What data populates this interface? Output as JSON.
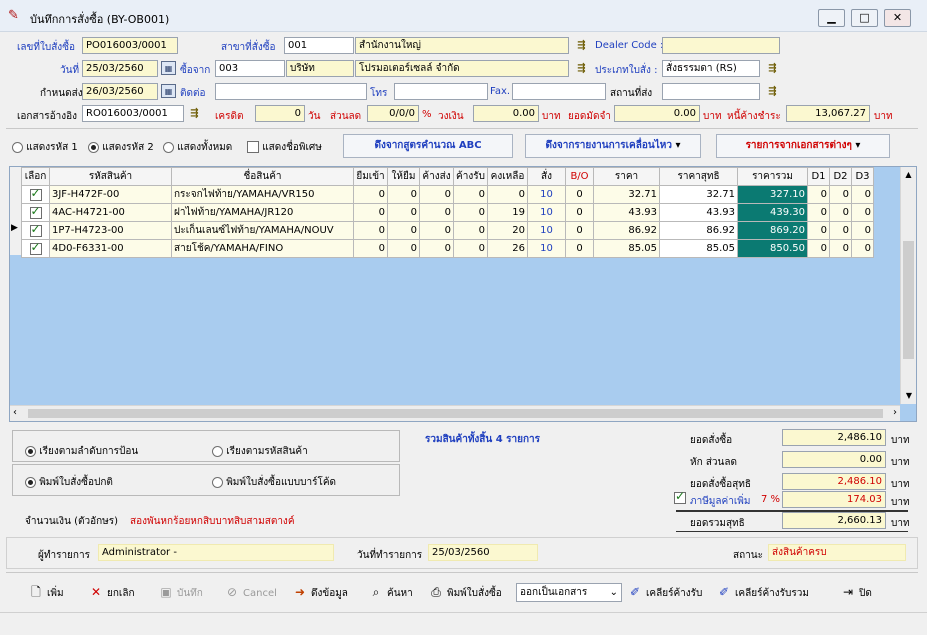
{
  "window": {
    "title": "บันทึกการสั่งซื้อ (BY-OB001)",
    "min": "▁",
    "max": "□",
    "close": "✕"
  },
  "header": {
    "doc_no_label": "เลขที่ใบสั่งซื้อ",
    "doc_no": "PO016003/0001",
    "branch_label": "สาขาที่สั่งซื้อ",
    "branch_code": "001",
    "branch_name": "สำนักงานใหญ่",
    "dealer_label": "Dealer Code :",
    "dealer_value": "",
    "date_label": "วันที่",
    "date": "25/03/2560",
    "buy_from_label": "ซื้อจาก",
    "vendor_code": "003",
    "vendor_type": "บริษัท",
    "vendor_name": "โปรมอเตอร์เซลล์ จำกัด",
    "order_type_label": "ประเภทใบสั่ง :",
    "order_type": "สั่งธรรมดา (RS)",
    "due_label": "กำหนดส่ง",
    "due_date": "26/03/2560",
    "contact_label": "ติดต่อ",
    "contact": "",
    "tel_label": "โทร",
    "tel": "",
    "fax_label": "Fax.",
    "fax": "",
    "ship_label": "สถานที่ส่ง",
    "ship": "",
    "ref_label": "เอกสารอ้างอิง",
    "ref_no": "RO016003/0001",
    "credit_label": "เครดิต",
    "credit": "0",
    "days_label": "วัน",
    "discount_label": "ส่วนลด",
    "discount": "0/0/0",
    "pct": "%",
    "limit_label": "วงเงิน",
    "limit": "0.00",
    "baht1": "บาท",
    "deposit_label": "ยอดมัดจำ",
    "deposit": "0.00",
    "baht2": "บาท",
    "debt_label": "หนี้ค้างชำระ",
    "debt": "13,067.27",
    "baht3": "บาท"
  },
  "options": {
    "show_code1": "แสดงรหัส 1",
    "show_code2": "แสดงรหัส 2",
    "show_all": "แสดงทั้งหมด",
    "show_special": "แสดงชื่อพิเศษ",
    "btn_abc": "ดึงจากสูตรคำนวณ ABC",
    "btn_movement": "ดึงจากรายงานการเคลื่อนไหว",
    "btn_docs": "รายการจากเอกสารต่างๆ"
  },
  "grid": {
    "columns": [
      "เลือก",
      "รหัสสินค้า",
      "ชื่อสินค้า",
      "ยืมเข้า",
      "ให้ยืม",
      "ค้างส่ง",
      "ค้างรับ",
      "คงเหลือ",
      "สั่ง",
      "B/O",
      "ราคา",
      "ราคาสุทธิ",
      "ราคารวม",
      "D1",
      "D2",
      "D3"
    ],
    "rows": [
      {
        "code": "3JF-H472F-00",
        "name": "กระจกไฟท้าย/YAMAHA/VR150",
        "borrow_in": "0",
        "lend": "0",
        "pend_send": "0",
        "pend_recv": "0",
        "stock": "0",
        "qty": "10",
        "bo": "0",
        "price": "32.71",
        "net": "32.71",
        "total": "327.10",
        "d1": "0",
        "d2": "0",
        "d3": "0"
      },
      {
        "code": "4AC-H4721-00",
        "name": "ฝาไฟท้าย/YAMAHA/JR120",
        "borrow_in": "0",
        "lend": "0",
        "pend_send": "0",
        "pend_recv": "0",
        "stock": "19",
        "qty": "10",
        "bo": "0",
        "price": "43.93",
        "net": "43.93",
        "total": "439.30",
        "d1": "0",
        "d2": "0",
        "d3": "0"
      },
      {
        "code": "1P7-H4723-00",
        "name": "ปะเก็นเลนซ์ไฟท้าย/YAMAHA/NOUV",
        "borrow_in": "0",
        "lend": "0",
        "pend_send": "0",
        "pend_recv": "0",
        "stock": "20",
        "qty": "10",
        "bo": "0",
        "price": "86.92",
        "net": "86.92",
        "total": "869.20",
        "d1": "0",
        "d2": "0",
        "d3": "0"
      },
      {
        "code": "4D0-F6331-00",
        "name": "สายโช้ค/YAMAHA/FINO",
        "borrow_in": "0",
        "lend": "0",
        "pend_send": "0",
        "pend_recv": "0",
        "stock": "26",
        "qty": "10",
        "bo": "0",
        "price": "85.05",
        "net": "85.05",
        "total": "850.50",
        "d1": "0",
        "d2": "0",
        "d3": "0"
      }
    ]
  },
  "sort": {
    "by_entry": "เรียงตามลำดับการป้อน",
    "by_code": "เรียงตามรหัสสินค้า",
    "print_normal": "พิมพ์ใบสั่งซื้อปกติ",
    "print_barcode": "พิมพ์ใบสั่งซื้อแบบบาร์โค้ด"
  },
  "summary": {
    "items_text": "รวมสินค้าทั้งสิ้น 4 รายการ",
    "total_label": "ยอดสั่งซื้อ",
    "total": "2,486.10",
    "disc_label": "หัก ส่วนลด",
    "disc": "0.00",
    "net_label": "ยอดสั่งซื้อสุทธิ",
    "net": "2,486.10",
    "vat_label": "ภาษีมูลค่าเพิ่ม",
    "vat_rate": "7 %",
    "vat": "174.03",
    "grand_label": "ยอดรวมสุทธิ",
    "grand": "2,660.13",
    "baht": "บาท"
  },
  "amount_words_label": "จำนวนเงิน (ตัวอักษร)",
  "amount_words": "สองพันหกร้อยหกสิบบาทสิบสามสตางค์",
  "footer": {
    "user_label": "ผู้ทำรายการ",
    "user": "Administrator -",
    "date_label": "วันที่ทำรายการ",
    "date": "25/03/2560",
    "status_label": "สถานะ",
    "status": "ส่งสินค้าครบ"
  },
  "toolbar": {
    "add": "เพิ่ม",
    "cancel_doc": "ยกเลิก",
    "save": "บันทึก",
    "cancel": "Cancel",
    "fetch": "ดึงข้อมูล",
    "search": "ค้นหา",
    "print": "พิมพ์ใบสั่งซื้อ",
    "output": "ออกเป็นเอกสาร",
    "clear_pending": "เคลียร์ค้างรับ",
    "clear_all": "เคลียร์ค้างรับรวม",
    "close": "ปิด"
  },
  "colors": {
    "teal": "#0b7a72",
    "yellow": "#fbf8d0",
    "blue_label": "#1f3fbf",
    "red": "#d00000",
    "grid_bg": "#a9ccef"
  }
}
